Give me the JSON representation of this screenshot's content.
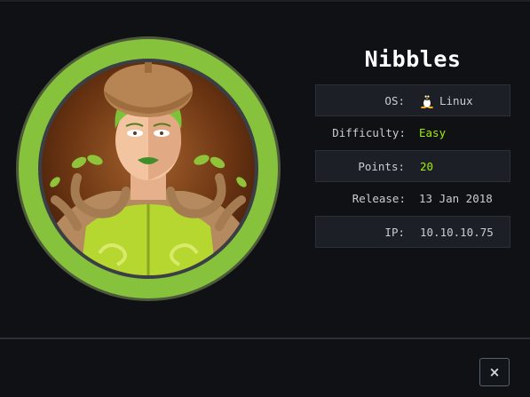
{
  "machine": {
    "name": "Nibbles",
    "avatar_alt": "nibbles-avatar"
  },
  "info": [
    {
      "label": "OS:",
      "value": "Linux",
      "icon": "linux-tux-icon",
      "highlight": false
    },
    {
      "label": "Difficulty:",
      "value": "Easy",
      "highlight": true
    },
    {
      "label": "Points:",
      "value": "20",
      "highlight": true
    },
    {
      "label": "Release:",
      "value": "13 Jan 2018",
      "highlight": false
    },
    {
      "label": "IP:",
      "value": "10.10.10.75",
      "highlight": false
    }
  ],
  "footer": {
    "close_label": "×"
  },
  "colors": {
    "accent_green": "#9fef00",
    "ring_green": "#86c23c",
    "background": "#0f1115"
  }
}
